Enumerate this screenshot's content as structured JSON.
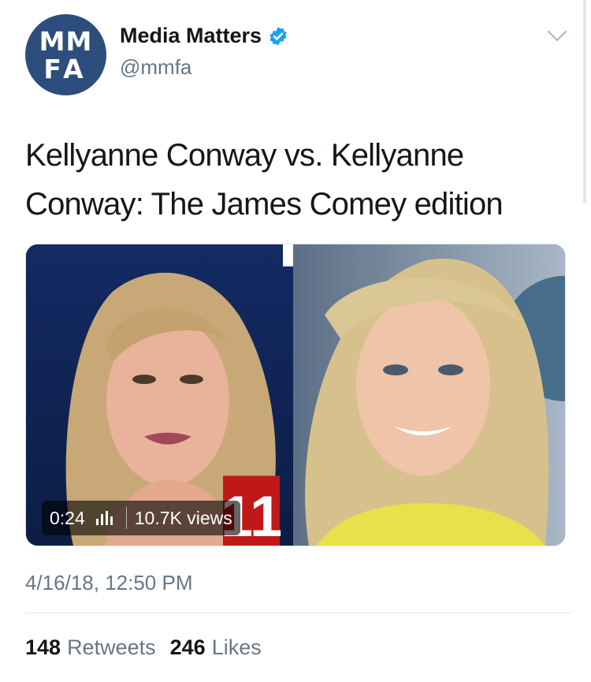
{
  "author": {
    "avatar_line1": "MM",
    "avatar_line2": "FA",
    "name": "Media Matters",
    "handle": "@mmfa",
    "verified": true
  },
  "tweet": {
    "text": "Kellyanne Conway vs. Kellyanne Conway: The James Comey edition",
    "timestamp": "4/16/18, 12:50 PM"
  },
  "video": {
    "duration": "0:24",
    "views": "10.7K views",
    "channel_number": "11"
  },
  "stats": {
    "retweets_count": "148",
    "retweets_label": "Retweets",
    "likes_count": "246",
    "likes_label": "Likes"
  },
  "icons": {
    "verified": "verified-badge-icon",
    "menu": "chevron-down-icon",
    "audio": "audio-bars-icon"
  },
  "colors": {
    "avatar_bg": "#2d4d7c",
    "verified": "#1da1f2",
    "secondary_text": "#657786",
    "primary_text": "#14171a"
  }
}
